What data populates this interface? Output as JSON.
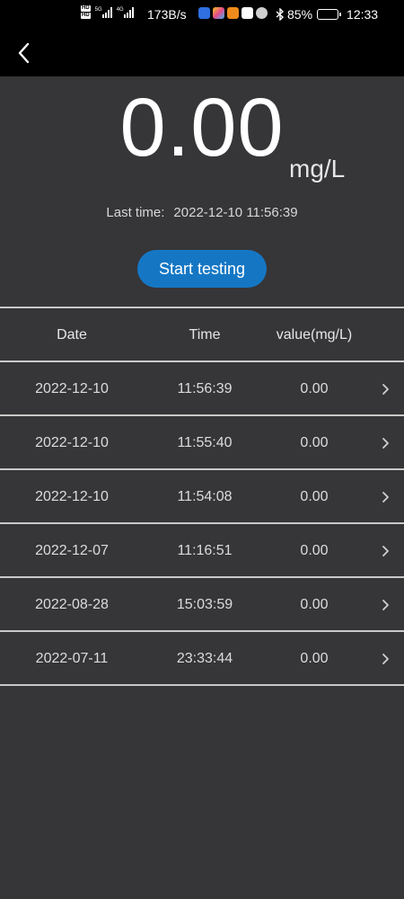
{
  "status_bar": {
    "network_tag_1": "5G",
    "network_tag_2": "4G",
    "speed": "173B/s",
    "battery": "85%",
    "battery_level": 0.85,
    "time": "12:33"
  },
  "reading": {
    "value": "0.00",
    "unit": "mg/L",
    "last_time_label": "Last time:",
    "last_time_value": "2022-12-10 11:56:39"
  },
  "actions": {
    "start_label": "Start testing"
  },
  "table": {
    "headers": [
      "Date",
      "Time",
      "value(mg/L)"
    ],
    "rows": [
      {
        "date": "2022-12-10",
        "time": "11:56:39",
        "value": "0.00"
      },
      {
        "date": "2022-12-10",
        "time": "11:55:40",
        "value": "0.00"
      },
      {
        "date": "2022-12-10",
        "time": "11:54:08",
        "value": "0.00"
      },
      {
        "date": "2022-12-07",
        "time": "11:16:51",
        "value": "0.00"
      },
      {
        "date": "2022-08-28",
        "time": "15:03:59",
        "value": "0.00"
      },
      {
        "date": "2022-07-11",
        "time": "23:33:44",
        "value": "0.00"
      }
    ]
  },
  "colors": {
    "background": "#363538",
    "bar": "#000000",
    "accent": "#1577c4",
    "divider": "#c9c9c9"
  },
  "icons": {
    "back": "chevron-left-icon",
    "row": "chevron-right-icon"
  }
}
